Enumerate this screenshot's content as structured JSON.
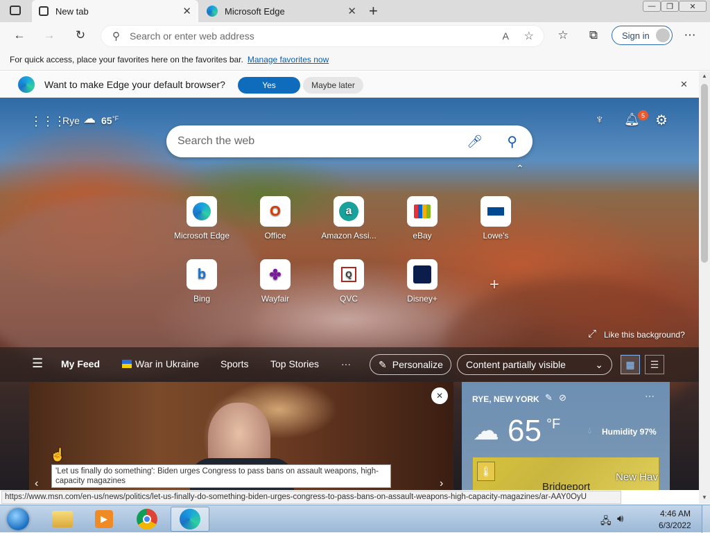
{
  "tabs": [
    {
      "label": "New tab",
      "active": true
    },
    {
      "label": "Microsoft Edge",
      "active": false
    }
  ],
  "window_controls": {
    "minimize": "—",
    "restore": "❐",
    "close": "✕"
  },
  "toolbar": {
    "address_placeholder": "Search or enter web address",
    "signin_label": "Sign in"
  },
  "favorites_bar": {
    "text": "For quick access, place your favorites here on the favorites bar.",
    "link": "Manage favorites now"
  },
  "default_banner": {
    "question": "Want to make Edge your default browser?",
    "yes": "Yes",
    "later": "Maybe later"
  },
  "weather_top": {
    "city": "Rye",
    "temp": "65",
    "unit": "°F"
  },
  "notifications": {
    "count": "5"
  },
  "search": {
    "placeholder": "Search the web"
  },
  "tiles": [
    {
      "label": "Microsoft Edge",
      "icon": "edge-icon"
    },
    {
      "label": "Office",
      "icon": "office-icon"
    },
    {
      "label": "Amazon Assi...",
      "icon": "amazon-icon"
    },
    {
      "label": "eBay",
      "icon": "ebay-icon"
    },
    {
      "label": "Lowe's",
      "icon": "lowes-icon"
    },
    {
      "label": "Bing",
      "icon": "bing-icon"
    },
    {
      "label": "Wayfair",
      "icon": "wayfair-icon"
    },
    {
      "label": "QVC",
      "icon": "qvc-icon"
    },
    {
      "label": "Disney+",
      "icon": "disney-icon"
    }
  ],
  "background": {
    "like_label": "Like this background?"
  },
  "feed": {
    "my_feed": "My Feed",
    "war": "War in Ukraine",
    "sports": "Sports",
    "top_stories": "Top Stories",
    "more": "···",
    "personalize": "Personalize",
    "content_visibility": "Content partially visible"
  },
  "weather_card": {
    "location": "RYE, NEW YORK",
    "temp": "65",
    "unit": "°F",
    "humidity": "Humidity 97%",
    "map_places": [
      "Bridgeport",
      "New Hav"
    ]
  },
  "tooltip": {
    "text": "'Let us finally do something': Biden urges Congress to pass bans on assault weapons, high-capacity magazines"
  },
  "statusbar": {
    "url": "https://www.msn.com/en-us/news/politics/let-us-finally-do-something-biden-urges-congress-to-pass-bans-on-assault-weapons-high-capacity-magazines/ar-AAY0OyU"
  },
  "taskbar": {
    "time": "4:46 AM",
    "date": "6/3/2022"
  },
  "colors": {
    "accent": "#0f6cbd",
    "badge": "#e8592f"
  }
}
